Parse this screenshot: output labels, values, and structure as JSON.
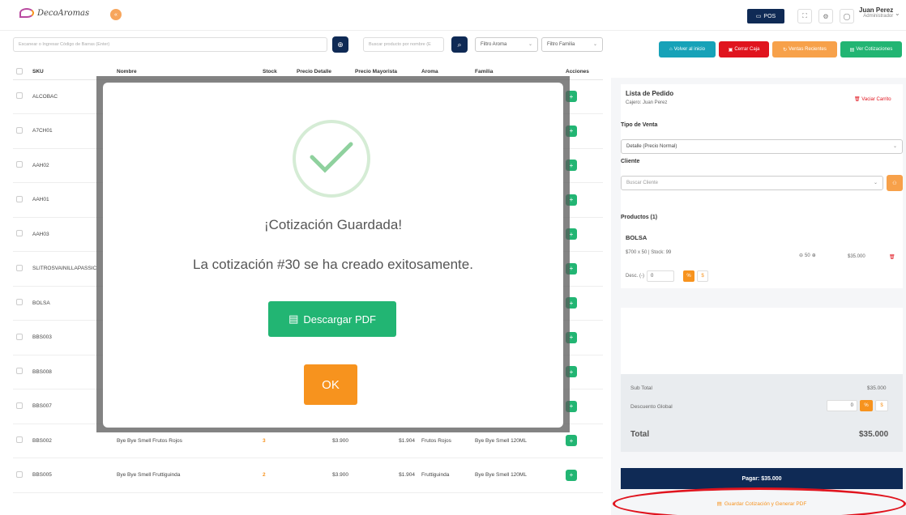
{
  "header": {
    "brand": "DecoAromas",
    "menu_badge": "«",
    "pos_label": "POS",
    "user_name": "Juan Perez",
    "user_role": "Administrador"
  },
  "filters": {
    "scan_placeholder": "Escanear o Ingresar Código de Barras (Enter)",
    "search_placeholder": "Buscar producto por nombre (E",
    "aroma_filter": "Filtro Aroma",
    "family_filter": "Filtro Familia"
  },
  "actions": {
    "home": "Volver al inicio",
    "close_register": "Cerrar Caja",
    "recent_sales": "Ventas Recientes",
    "quotes": "Ver Cotizaciones"
  },
  "table": {
    "headers": [
      "SKU",
      "Nombre",
      "Stock",
      "Precio Detalle",
      "Precio Mayorista",
      "Aroma",
      "Familia",
      "Acciones"
    ],
    "rows": [
      {
        "sku": "ALCOBAC",
        "name": "",
        "stock": "",
        "retail": "",
        "wholesale": "",
        "aroma": "",
        "family": ""
      },
      {
        "sku": "A7CH01",
        "name": "",
        "stock": "",
        "retail": "",
        "wholesale": "",
        "aroma": "",
        "family": ""
      },
      {
        "sku": "AAH02",
        "name": "",
        "stock": "",
        "retail": "",
        "wholesale": "",
        "aroma": "",
        "family": ""
      },
      {
        "sku": "AAH01",
        "name": "",
        "stock": "",
        "retail": "",
        "wholesale": "",
        "aroma": "",
        "family": ""
      },
      {
        "sku": "AAH03",
        "name": "",
        "stock": "",
        "retail": "",
        "wholesale": "",
        "aroma": "",
        "family": ""
      },
      {
        "sku": "SLITROSVAINILLAPASSIC",
        "name": "",
        "stock": "",
        "retail": "",
        "wholesale": "",
        "aroma": "",
        "family": ""
      },
      {
        "sku": "BOLSA",
        "name": "",
        "stock": "",
        "retail": "",
        "wholesale": "",
        "aroma": "",
        "family": ""
      },
      {
        "sku": "BBS003",
        "name": "",
        "stock": "",
        "retail": "",
        "wholesale": "",
        "aroma": "",
        "family": ""
      },
      {
        "sku": "BBS008",
        "name": "",
        "stock": "",
        "retail": "",
        "wholesale": "",
        "aroma": "",
        "family": ""
      },
      {
        "sku": "BBS007",
        "name": "",
        "stock": "",
        "retail": "",
        "wholesale": "",
        "aroma": "",
        "family": ""
      },
      {
        "sku": "BBS002",
        "name": "Bye Bye Smell Frutos Rojos",
        "stock": "3",
        "retail": "$3.900",
        "wholesale": "$1.904",
        "aroma": "Frutos Rojos",
        "family": "Bye Bye Smell 120ML"
      },
      {
        "sku": "BBS005",
        "name": "Bye Bye Smell Fruttiguinda",
        "stock": "2",
        "retail": "$3.900",
        "wholesale": "$1.904",
        "aroma": "Fruttiguinda",
        "family": "Bye Bye Smell 120ML"
      }
    ]
  },
  "modal": {
    "title": "¡Cotización Guardada!",
    "message": "La cotización #30 se ha creado exitosamente.",
    "pdf_button": "Descargar PDF",
    "ok_button": "OK"
  },
  "cart": {
    "title": "Lista de Pedido",
    "cashier": "Cajero: Juan Perez",
    "empty_label": "Vaciar Carrito",
    "sale_type_label": "Tipo de Venta",
    "sale_type_value": "Detalle (Precio Normal)",
    "client_label": "Cliente",
    "client_placeholder": "Buscar Cliente",
    "products_label": "Productos (1)",
    "item": {
      "name": "BOLSA",
      "meta": "$700 x 50 | Stock: 99",
      "qty": "50",
      "total": "$35.000",
      "discount_label": "Desc. (-)",
      "discount_value": "0",
      "pct": "%",
      "cur": "$"
    }
  },
  "summary": {
    "subtotal_label": "Sub Total",
    "subtotal_value": "$35.000",
    "global_discount_label": "Descuento Global",
    "global_discount_value": "0",
    "total_label": "Total",
    "total_value": "$35.000",
    "pay_label": "Pagar: $35.000",
    "save_label": "Guardar Cotización y Generar PDF"
  },
  "colors": {
    "navy": "#0f2a55",
    "green": "#22b573",
    "orange": "#f7931e",
    "red": "#e0141e",
    "teal": "#17a2b8"
  }
}
